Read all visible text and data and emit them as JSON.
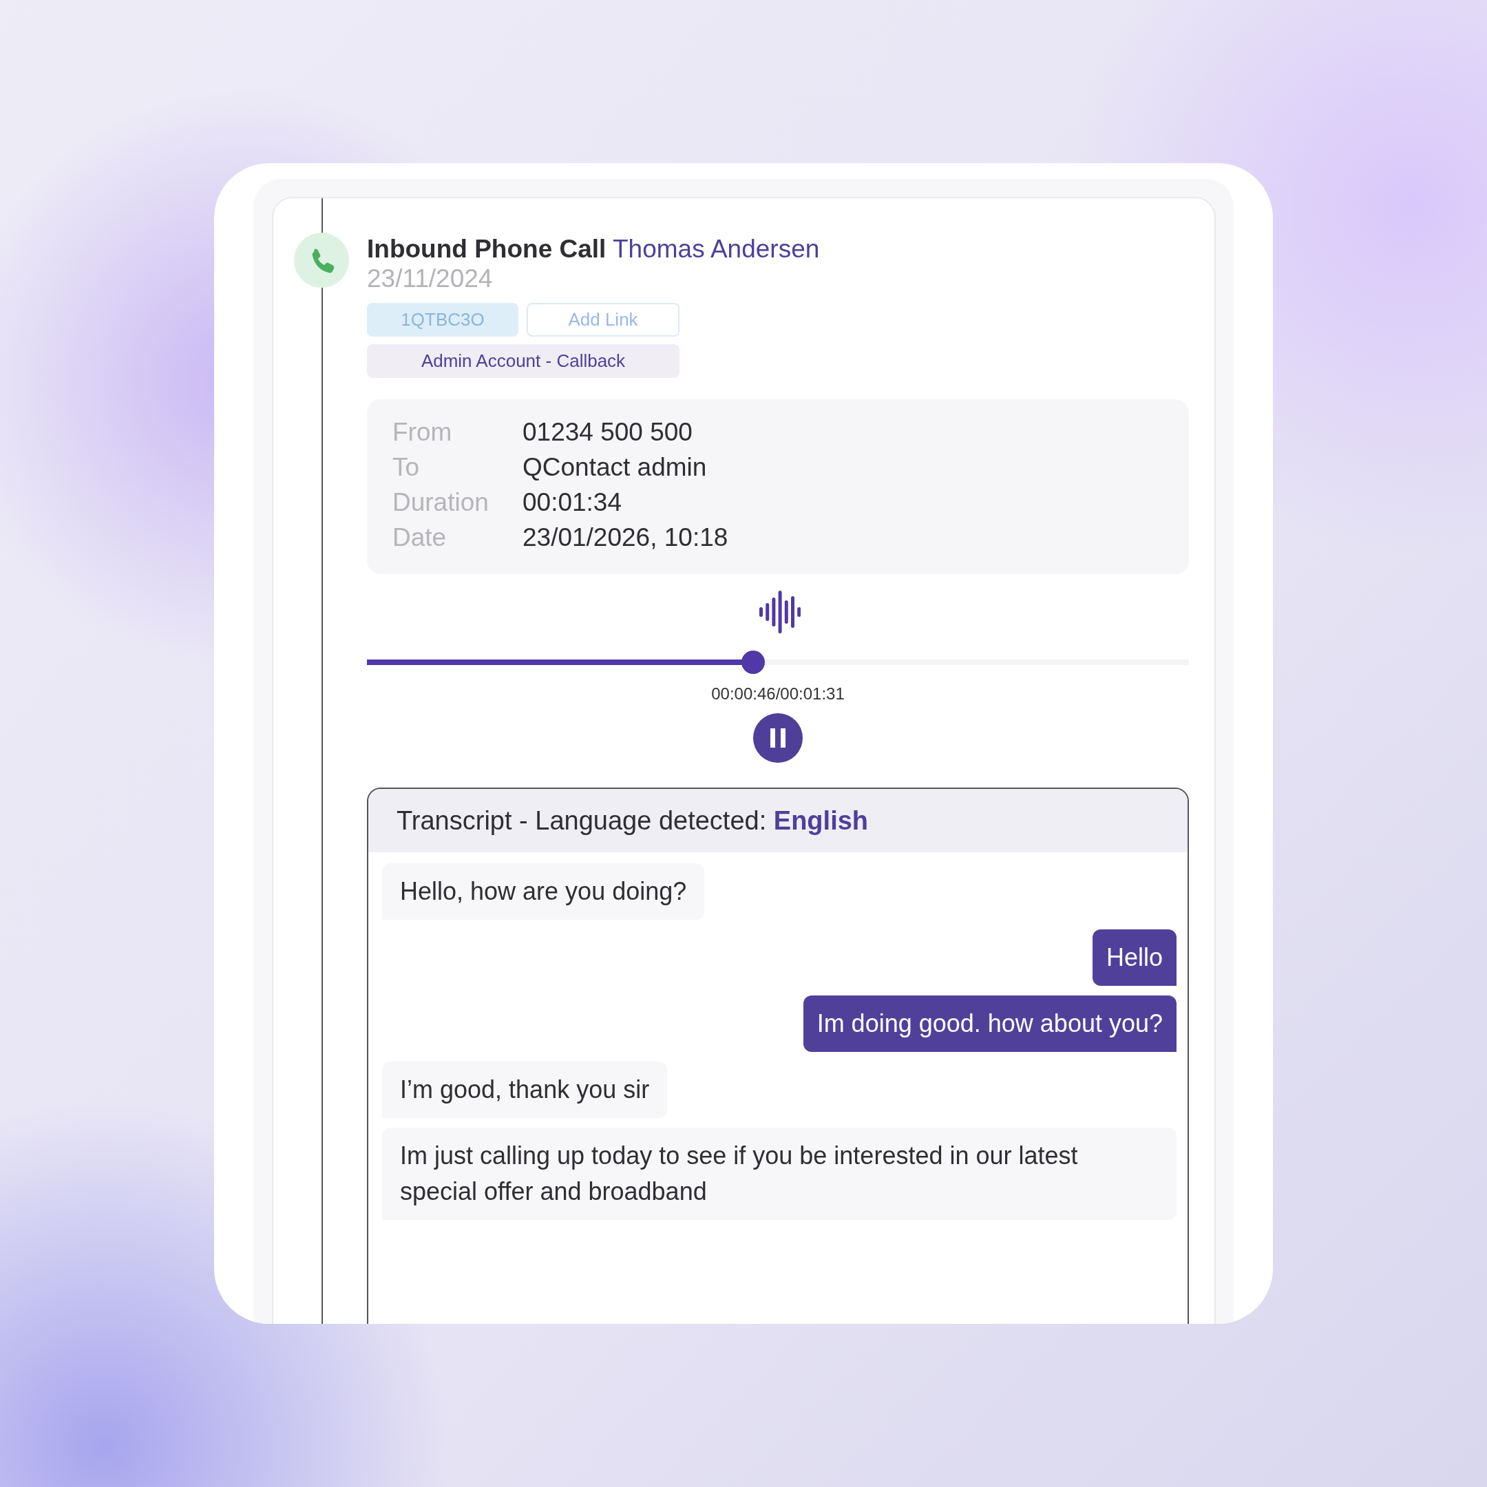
{
  "call": {
    "type": "Inbound Phone Call",
    "contact": "Thomas Andersen",
    "date": "23/11/2024"
  },
  "tags": [
    {
      "label": "1QTBC3O",
      "kind": "reference"
    },
    {
      "label": "Add Link",
      "kind": "link"
    },
    {
      "label": "Admin Account - Callback",
      "kind": "category"
    }
  ],
  "details": [
    {
      "label": "From",
      "value": "01234 500 500"
    },
    {
      "label": "To",
      "value": "QContact admin"
    },
    {
      "label": "Duration",
      "value": "00:01:34"
    },
    {
      "label": "Date",
      "value": "23/01/2026, 10:18"
    }
  ],
  "player": {
    "level": 0.47,
    "time": "00:00:46/00:01:31",
    "playing": true
  },
  "transcript": {
    "title": "Transcript - Language detected: **English**",
    "messages": [
      {
        "kind": "received",
        "text": "Hello, how are you doing?"
      },
      {
        "kind": "sent",
        "text": "Hello"
      },
      {
        "kind": "sent",
        "text": "Im doing good. how about you?"
      },
      {
        "kind": "received",
        "text": "I’m good, thank you sir"
      },
      {
        "kind": "received",
        "text": "Im just calling up today to see if you be interested in our latest special offer and broadband"
      }
    ]
  }
}
